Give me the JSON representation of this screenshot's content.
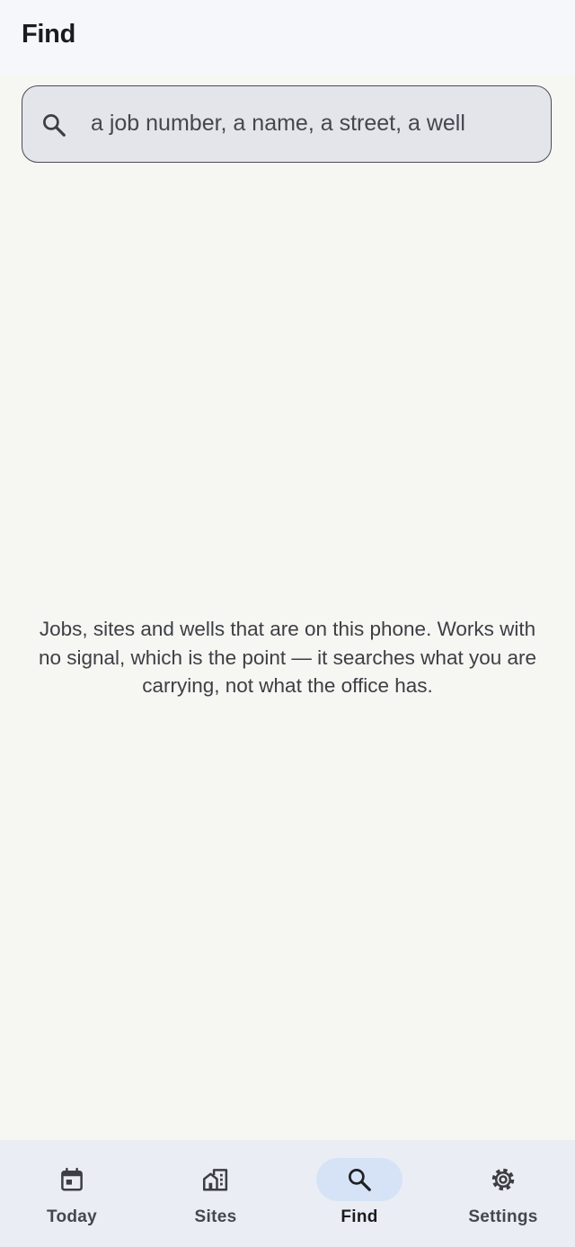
{
  "app_bar": {
    "title": "Find"
  },
  "search": {
    "placeholder": "a job number, a name, a street, a well",
    "value": "",
    "icon": "search-icon"
  },
  "empty_state": {
    "message": "Jobs, sites and wells that are on this phone. Works with no signal, which is the point — it searches what you are carrying, not what the office has."
  },
  "bottom_nav": {
    "active": "Find",
    "active_indicator_color": "#d6e3f7",
    "items": [
      {
        "label": "Today",
        "icon": "calendar-icon"
      },
      {
        "label": "Sites",
        "icon": "buildings-icon"
      },
      {
        "label": "Find",
        "icon": "search-icon"
      },
      {
        "label": "Settings",
        "icon": "gear-icon"
      }
    ]
  }
}
